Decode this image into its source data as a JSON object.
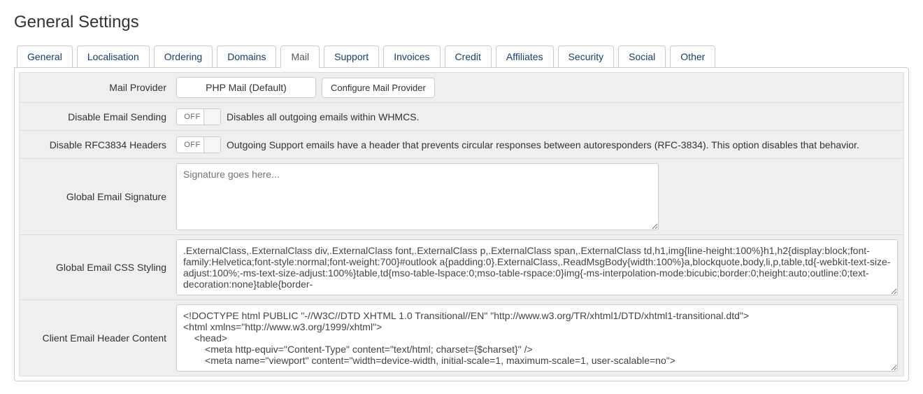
{
  "page": {
    "title": "General Settings"
  },
  "tabs": [
    {
      "label": "General"
    },
    {
      "label": "Localisation"
    },
    {
      "label": "Ordering"
    },
    {
      "label": "Domains"
    },
    {
      "label": "Mail",
      "active": true
    },
    {
      "label": "Support"
    },
    {
      "label": "Invoices"
    },
    {
      "label": "Credit"
    },
    {
      "label": "Affiliates"
    },
    {
      "label": "Security"
    },
    {
      "label": "Social"
    },
    {
      "label": "Other"
    }
  ],
  "rows": {
    "mail_provider": {
      "label": "Mail Provider",
      "value": "PHP Mail (Default)",
      "button": "Configure Mail Provider"
    },
    "disable_sending": {
      "label": "Disable Email Sending",
      "toggle": "OFF",
      "desc": "Disables all outgoing emails within WHMCS."
    },
    "disable_rfc3834": {
      "label": "Disable RFC3834 Headers",
      "toggle": "OFF",
      "desc": "Outgoing Support emails have a header that prevents circular responses between autoresponders (RFC-3834). This option disables that behavior."
    },
    "signature": {
      "label": "Global Email Signature",
      "placeholder": "Signature goes here..."
    },
    "css": {
      "label": "Global Email CSS Styling",
      "value": ".ExternalClass,.ExternalClass div,.ExternalClass font,.ExternalClass p,.ExternalClass span,.ExternalClass td,h1,img{line-height:100%}h1,h2{display:block;font-family:Helvetica;font-style:normal;font-weight:700}#outlook a{padding:0}.ExternalClass,.ReadMsgBody{width:100%}a,blockquote,body,li,p,table,td{-webkit-text-size-adjust:100%;-ms-text-size-adjust:100%}table,td{mso-table-lspace:0;mso-table-rspace:0}img{-ms-interpolation-mode:bicubic;border:0;height:auto;outline:0;text-decoration:none}table{border-"
    },
    "header": {
      "label": "Client Email Header Content",
      "value": "<!DOCTYPE html PUBLIC \"-//W3C//DTD XHTML 1.0 Transitional//EN\" \"http://www.w3.org/TR/xhtml1/DTD/xhtml1-transitional.dtd\">\n<html xmlns=\"http://www.w3.org/1999/xhtml\">\n    <head>\n        <meta http-equiv=\"Content-Type\" content=\"text/html; charset={$charset}\" />\n        <meta name=\"viewport\" content=\"width=device-width, initial-scale=1, maximum-scale=1, user-scalable=no\">"
    }
  }
}
